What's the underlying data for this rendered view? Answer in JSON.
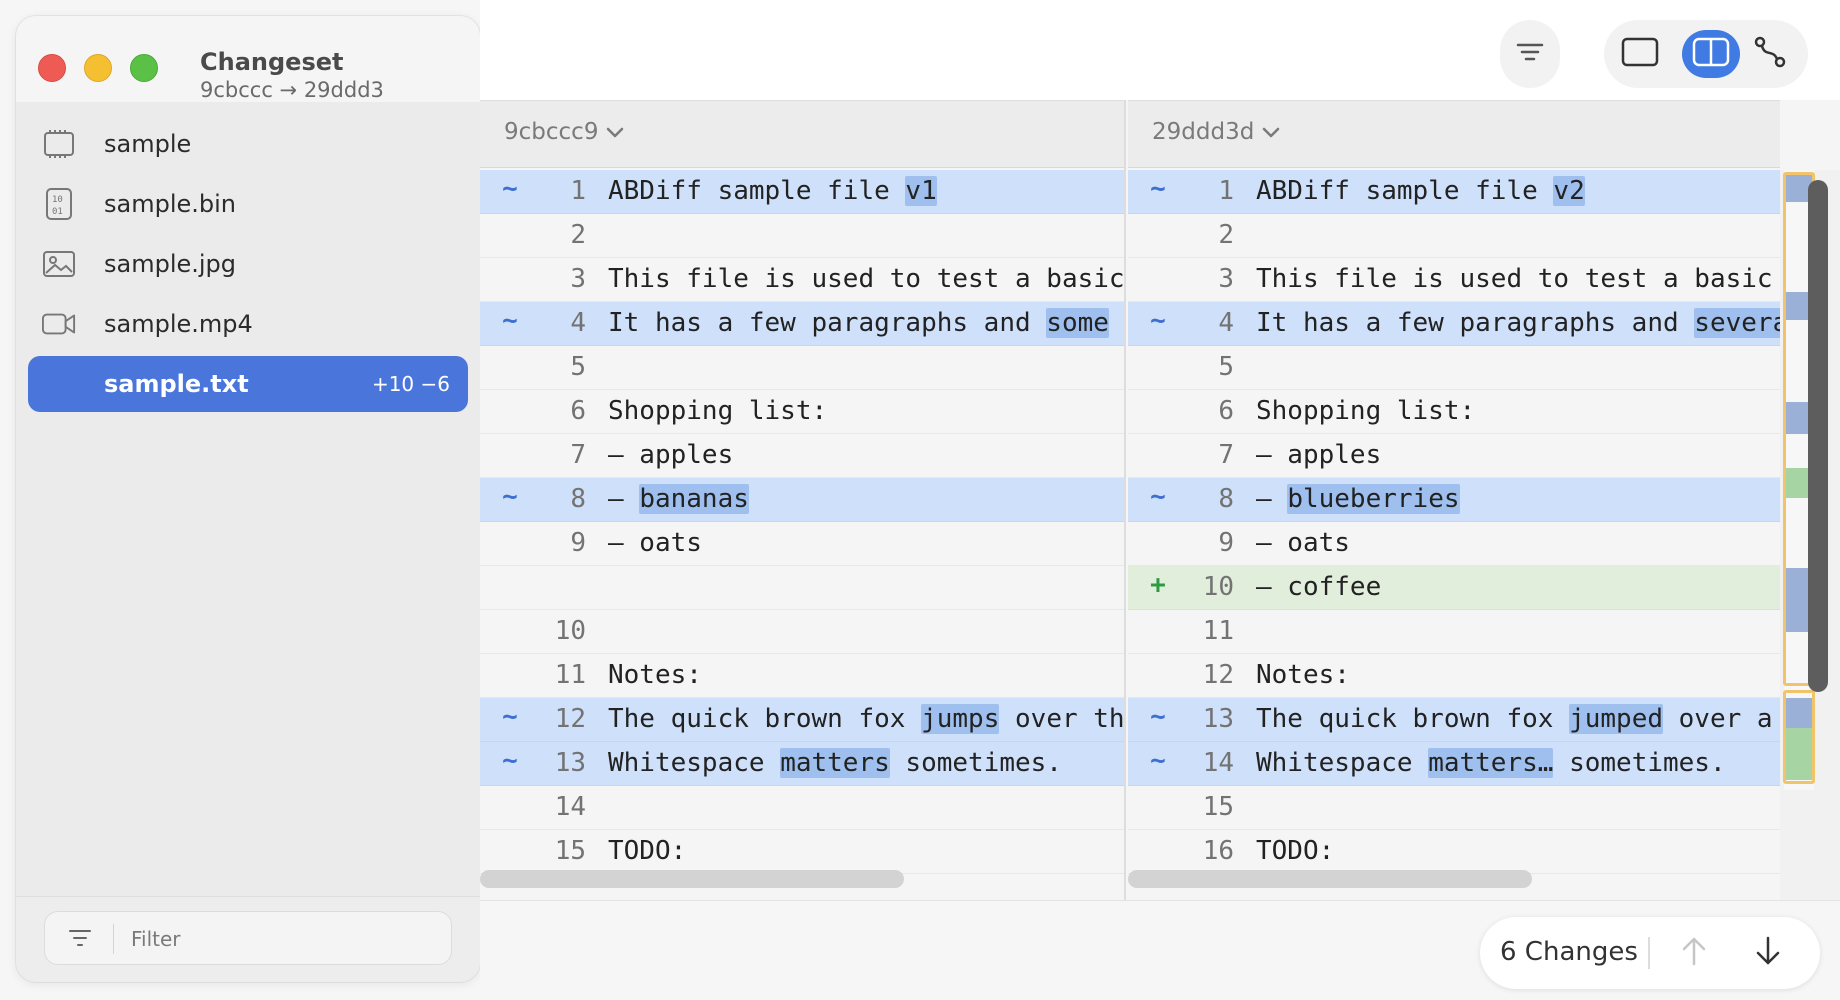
{
  "window": {
    "title": "Changeset",
    "subtitle": "9cbccc → 29ddd3"
  },
  "sidebar": {
    "files": [
      {
        "name": "sample",
        "icon": "chip-icon"
      },
      {
        "name": "sample.bin",
        "icon": "binary-file-icon"
      },
      {
        "name": "sample.jpg",
        "icon": "photo-icon"
      },
      {
        "name": "sample.mp4",
        "icon": "video-icon"
      },
      {
        "name": "sample.txt",
        "icon": "text-file-icon",
        "stats": "+10 −6"
      }
    ],
    "filter_placeholder": "Filter"
  },
  "diff": {
    "left": {
      "revision": "9cbccc9",
      "lines": [
        {
          "num": "1",
          "status": "mod",
          "marker": "~",
          "parts": [
            {
              "t": "ABDiff sample file "
            },
            {
              "t": "v1",
              "hl": true
            }
          ]
        },
        {
          "num": "2",
          "status": "same",
          "marker": "",
          "parts": [
            {
              "t": ""
            }
          ]
        },
        {
          "num": "3",
          "status": "same",
          "marker": "",
          "parts": [
            {
              "t": "This file is used to test a basic"
            }
          ]
        },
        {
          "num": "4",
          "status": "mod",
          "marker": "~",
          "parts": [
            {
              "t": "It has a few paragraphs and "
            },
            {
              "t": "some",
              "hl": true
            }
          ]
        },
        {
          "num": "5",
          "status": "same",
          "marker": "",
          "parts": [
            {
              "t": ""
            }
          ]
        },
        {
          "num": "6",
          "status": "same",
          "marker": "",
          "parts": [
            {
              "t": "Shopping list:"
            }
          ]
        },
        {
          "num": "7",
          "status": "same",
          "marker": "",
          "parts": [
            {
              "t": "– apples"
            }
          ]
        },
        {
          "num": "8",
          "status": "mod",
          "marker": "~",
          "parts": [
            {
              "t": "– "
            },
            {
              "t": "bananas",
              "hl": true
            }
          ]
        },
        {
          "num": "9",
          "status": "same",
          "marker": "",
          "parts": [
            {
              "t": "– oats"
            }
          ]
        },
        {
          "num": "",
          "status": "blank",
          "marker": "",
          "parts": [
            {
              "t": ""
            }
          ]
        },
        {
          "num": "10",
          "status": "same",
          "marker": "",
          "parts": [
            {
              "t": ""
            }
          ]
        },
        {
          "num": "11",
          "status": "same",
          "marker": "",
          "parts": [
            {
              "t": "Notes:"
            }
          ]
        },
        {
          "num": "12",
          "status": "mod",
          "marker": "~",
          "parts": [
            {
              "t": "The quick brown fox "
            },
            {
              "t": "jumps",
              "hl": true
            },
            {
              "t": " over th"
            }
          ]
        },
        {
          "num": "13",
          "status": "mod",
          "marker": "~",
          "parts": [
            {
              "t": "Whitespace "
            },
            {
              "t": "matters",
              "hl": true
            },
            {
              "t": " sometimes."
            }
          ]
        },
        {
          "num": "14",
          "status": "same",
          "marker": "",
          "parts": [
            {
              "t": ""
            }
          ]
        },
        {
          "num": "15",
          "status": "same",
          "marker": "",
          "parts": [
            {
              "t": "TODO:"
            }
          ]
        }
      ]
    },
    "right": {
      "revision": "29ddd3d",
      "lines": [
        {
          "num": "1",
          "status": "mod",
          "marker": "~",
          "parts": [
            {
              "t": "ABDiff sample file "
            },
            {
              "t": "v2",
              "hl": true
            }
          ]
        },
        {
          "num": "2",
          "status": "same",
          "marker": "",
          "parts": [
            {
              "t": ""
            }
          ]
        },
        {
          "num": "3",
          "status": "same",
          "marker": "",
          "parts": [
            {
              "t": "This file is used to test a basic"
            }
          ]
        },
        {
          "num": "4",
          "status": "mod",
          "marker": "~",
          "parts": [
            {
              "t": "It has a few paragraphs and "
            },
            {
              "t": "several",
              "hl": true
            }
          ]
        },
        {
          "num": "5",
          "status": "same",
          "marker": "",
          "parts": [
            {
              "t": ""
            }
          ]
        },
        {
          "num": "6",
          "status": "same",
          "marker": "",
          "parts": [
            {
              "t": "Shopping list:"
            }
          ]
        },
        {
          "num": "7",
          "status": "same",
          "marker": "",
          "parts": [
            {
              "t": "– apples"
            }
          ]
        },
        {
          "num": "8",
          "status": "mod",
          "marker": "~",
          "parts": [
            {
              "t": "– "
            },
            {
              "t": "blueberries",
              "hl": true
            }
          ]
        },
        {
          "num": "9",
          "status": "same",
          "marker": "",
          "parts": [
            {
              "t": "– oats"
            }
          ]
        },
        {
          "num": "10",
          "status": "add",
          "marker": "+",
          "parts": [
            {
              "t": "– coffee"
            }
          ]
        },
        {
          "num": "11",
          "status": "same",
          "marker": "",
          "parts": [
            {
              "t": ""
            }
          ]
        },
        {
          "num": "12",
          "status": "same",
          "marker": "",
          "parts": [
            {
              "t": "Notes:"
            }
          ]
        },
        {
          "num": "13",
          "status": "mod",
          "marker": "~",
          "parts": [
            {
              "t": "The quick brown fox "
            },
            {
              "t": "jumped",
              "hl": true
            },
            {
              "t": " over a"
            }
          ]
        },
        {
          "num": "14",
          "status": "mod",
          "marker": "~",
          "parts": [
            {
              "t": "Whitespace "
            },
            {
              "t": "matters…",
              "hl": true
            },
            {
              "t": " sometimes."
            }
          ]
        },
        {
          "num": "15",
          "status": "same",
          "marker": "",
          "parts": [
            {
              "t": ""
            }
          ]
        },
        {
          "num": "16",
          "status": "same",
          "marker": "",
          "parts": [
            {
              "t": "TODO:"
            }
          ]
        }
      ]
    }
  },
  "footer": {
    "changes_label": "6 Changes"
  },
  "colors": {
    "accent": "#3f7be2",
    "selected_row": "#4a76dc",
    "modified_line": "#cfe0fa",
    "added_line": "#e1eedc",
    "highlight": "#9fc0ee"
  }
}
